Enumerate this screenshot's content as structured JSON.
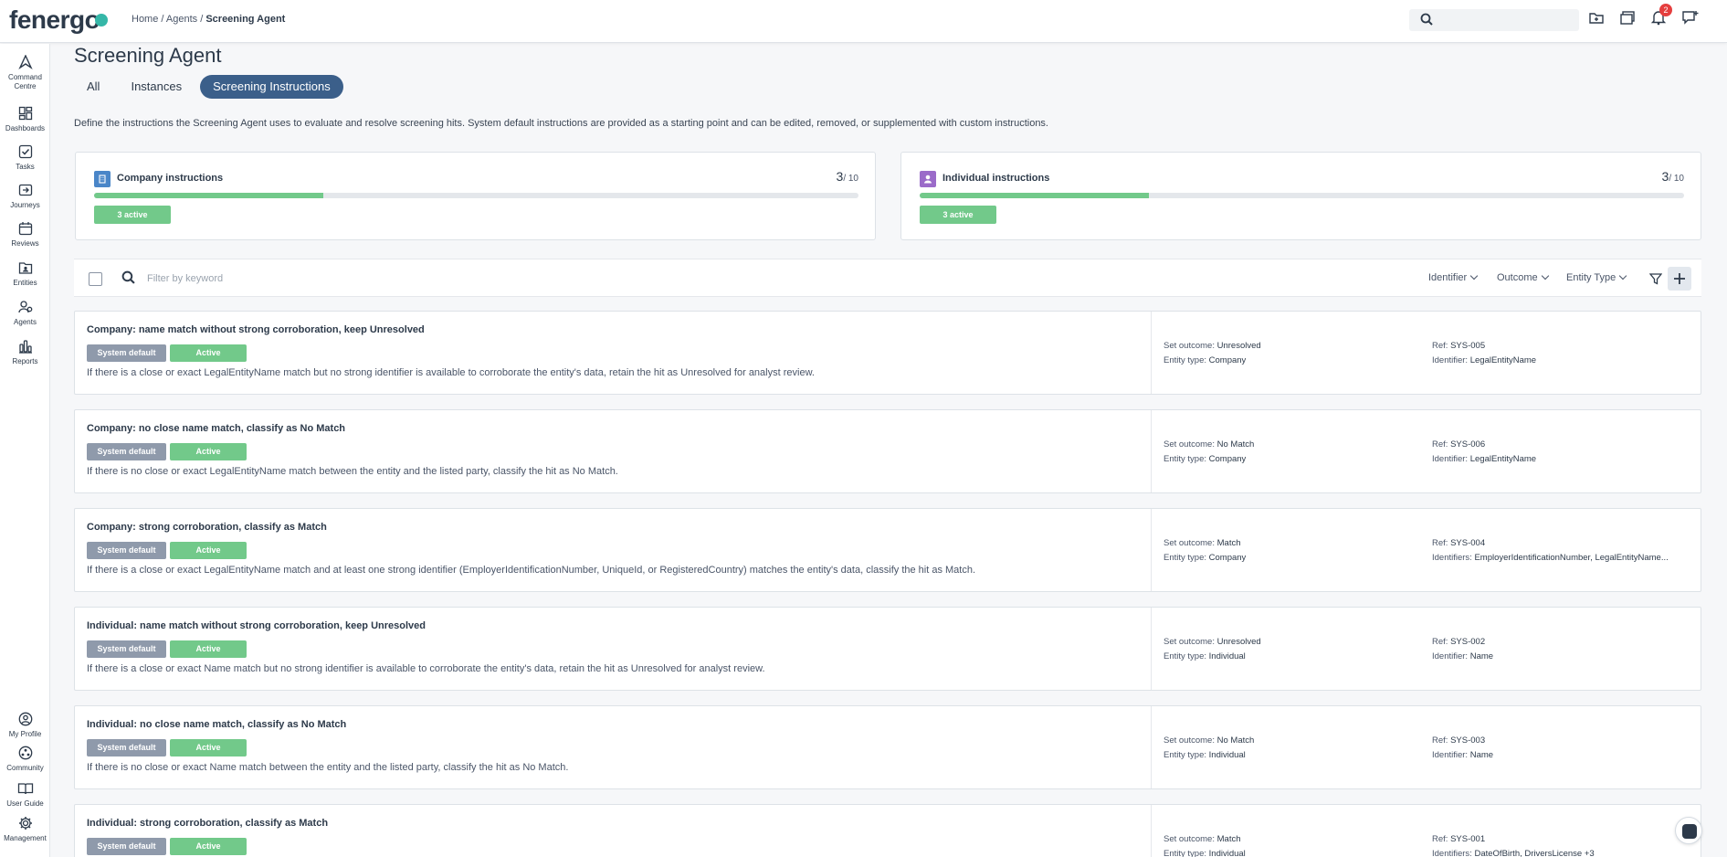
{
  "app": {
    "logo_text": "fenergo",
    "brand_color": "#35b7a8",
    "accent_color": "#3b5f8a",
    "active_color": "#72c98a"
  },
  "breadcrumb": {
    "home": "Home",
    "agents": "Agents",
    "current": "Screening Agent",
    "separator": " / "
  },
  "search": {
    "placeholder": ""
  },
  "top_icons": {
    "notifications_count": "2",
    "icons": [
      "add-folder-icon",
      "folders-icon",
      "bell-icon",
      "messages-icon"
    ]
  },
  "sidebar": {
    "items": [
      {
        "label": "Command Centre",
        "icon": "command-centre-icon"
      },
      {
        "label": "Dashboards",
        "icon": "dashboards-icon"
      },
      {
        "label": "Tasks",
        "icon": "tasks-icon"
      },
      {
        "label": "Journeys",
        "icon": "journeys-icon"
      },
      {
        "label": "Reviews",
        "icon": "reviews-icon"
      },
      {
        "label": "Entities",
        "icon": "entities-icon"
      },
      {
        "label": "Agents",
        "icon": "agents-icon"
      },
      {
        "label": "Reports",
        "icon": "reports-icon"
      }
    ],
    "bottom_items": [
      {
        "label": "My Profile",
        "icon": "profile-icon"
      },
      {
        "label": "Community",
        "icon": "community-icon"
      },
      {
        "label": "User Guide",
        "icon": "book-icon"
      },
      {
        "label": "Management",
        "icon": "gear-icon"
      }
    ]
  },
  "page": {
    "title": "Screening Agent",
    "tabs": [
      {
        "label": "All",
        "active": false
      },
      {
        "label": "Instances",
        "active": false
      },
      {
        "label": "Screening Instructions",
        "active": true
      }
    ],
    "intro": "Define the instructions the Screening Agent uses to evaluate and resolve screening hits. System default instructions are provided as a starting point and can be edited, removed, or supplemented with custom instructions."
  },
  "cards": [
    {
      "title": "Company instructions",
      "count": "3",
      "total": "/ 10",
      "fill_fraction": 0.3,
      "active_label": "3 active",
      "icon": "building-icon",
      "icon_color": "#4a86c8"
    },
    {
      "title": "Individual instructions",
      "count": "3",
      "total": "/ 10",
      "fill_fraction": 0.3,
      "active_label": "3 active",
      "icon": "person-icon",
      "icon_color": "#9b6bc9"
    }
  ],
  "filter": {
    "placeholder": "Filter by keyword",
    "value": "",
    "identifier_label": "Identifier",
    "outcome_label": "Outcome",
    "entity_type_label": "Entity Type"
  },
  "labels": {
    "system_default": "System default",
    "active": "Active",
    "set_outcome": "Set outcome:",
    "entity_type": "Entity type:",
    "ref": "Ref:",
    "identifier": "Identifier:",
    "identifiers": "Identifiers:"
  },
  "instructions": [
    {
      "title": "Company: name match without strong corroboration, keep Unresolved",
      "description": "If there is a close or exact LegalEntityName match but no strong identifier is available to corroborate the entity's data, retain the hit as Unresolved for analyst review.",
      "outcome": "Unresolved",
      "entity_type": "Company",
      "ref": "SYS-005",
      "identifier_label": "Identifier:",
      "identifiers": "LegalEntityName"
    },
    {
      "title": "Company: no close name match, classify as No Match",
      "description": "If there is no close or exact LegalEntityName match between the entity and the listed party, classify the hit as No Match.",
      "outcome": "No Match",
      "entity_type": "Company",
      "ref": "SYS-006",
      "identifier_label": "Identifier:",
      "identifiers": "LegalEntityName"
    },
    {
      "title": "Company: strong corroboration, classify as Match",
      "description": "If there is a close or exact LegalEntityName match and at least one strong identifier (EmployerIdentificationNumber, UniqueId, or RegisteredCountry) matches the entity's data, classify the hit as Match.",
      "outcome": "Match",
      "entity_type": "Company",
      "ref": "SYS-004",
      "identifier_label": "Identifiers:",
      "identifiers": "EmployerIdentificationNumber, LegalEntityName..."
    },
    {
      "title": "Individual: name match without strong corroboration, keep Unresolved",
      "description": "If there is a close or exact Name match but no strong identifier is available to corroborate the entity's data, retain the hit as Unresolved for analyst review.",
      "outcome": "Unresolved",
      "entity_type": "Individual",
      "ref": "SYS-002",
      "identifier_label": "Identifier:",
      "identifiers": "Name"
    },
    {
      "title": "Individual: no close name match, classify as No Match",
      "description": "If there is no close or exact Name match between the entity and the listed party, classify the hit as No Match.",
      "outcome": "No Match",
      "entity_type": "Individual",
      "ref": "SYS-003",
      "identifier_label": "Identifier:",
      "identifiers": "Name"
    },
    {
      "title": "Individual: strong corroboration, classify as Match",
      "description": "",
      "outcome": "Match",
      "entity_type": "Individual",
      "ref": "SYS-001",
      "identifier_label": "Identifiers:",
      "identifiers": "DateOfBirth, DriversLicense +3"
    }
  ]
}
